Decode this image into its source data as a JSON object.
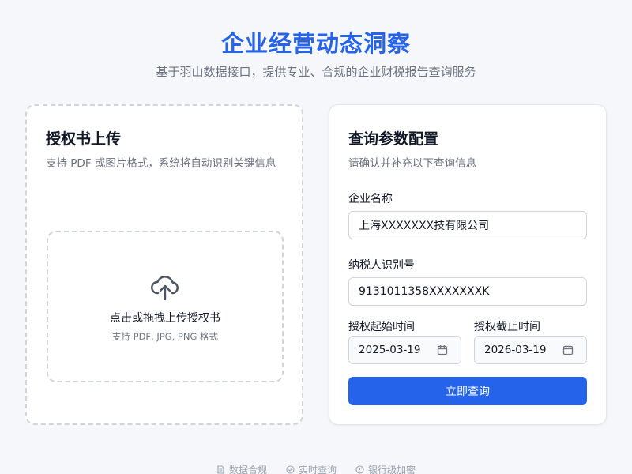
{
  "header": {
    "title": "企业经营动态洞察",
    "subtitle": "基于羽山数据接口，提供专业、合规的企业财税报告查询服务"
  },
  "upload_card": {
    "title": "授权书上传",
    "description": "支持 PDF 或图片格式，系统将自动识别关键信息",
    "dropzone_title": "点击或拖拽上传授权书",
    "dropzone_hint": "支持 PDF, JPG, PNG 格式",
    "icon": "cloud-upload-icon"
  },
  "query_card": {
    "title": "查询参数配置",
    "description": "请确认并补充以下查询信息",
    "company_name_label": "企业名称",
    "company_name_value": "上海XXXXXXX技有限公司",
    "tax_id_label": "纳税人识别号",
    "tax_id_value": "9131011358XXXXXXXK",
    "start_date_label": "授权起始时间",
    "start_date_value": "2025-03-19",
    "end_date_label": "授权截止时间",
    "end_date_value": "2026-03-19",
    "submit_label": "立即查询",
    "date_icon": "calendar-icon"
  },
  "footer": {
    "items": [
      {
        "label": "数据合规",
        "icon": "document-icon"
      },
      {
        "label": "实时查询",
        "icon": "check-circle-icon"
      },
      {
        "label": "银行级加密",
        "icon": "info-circle-icon"
      }
    ]
  },
  "colors": {
    "accent": "#2563eb",
    "background": "#f5f7fb",
    "muted_text": "#6b7280",
    "border": "#d1d5db"
  }
}
